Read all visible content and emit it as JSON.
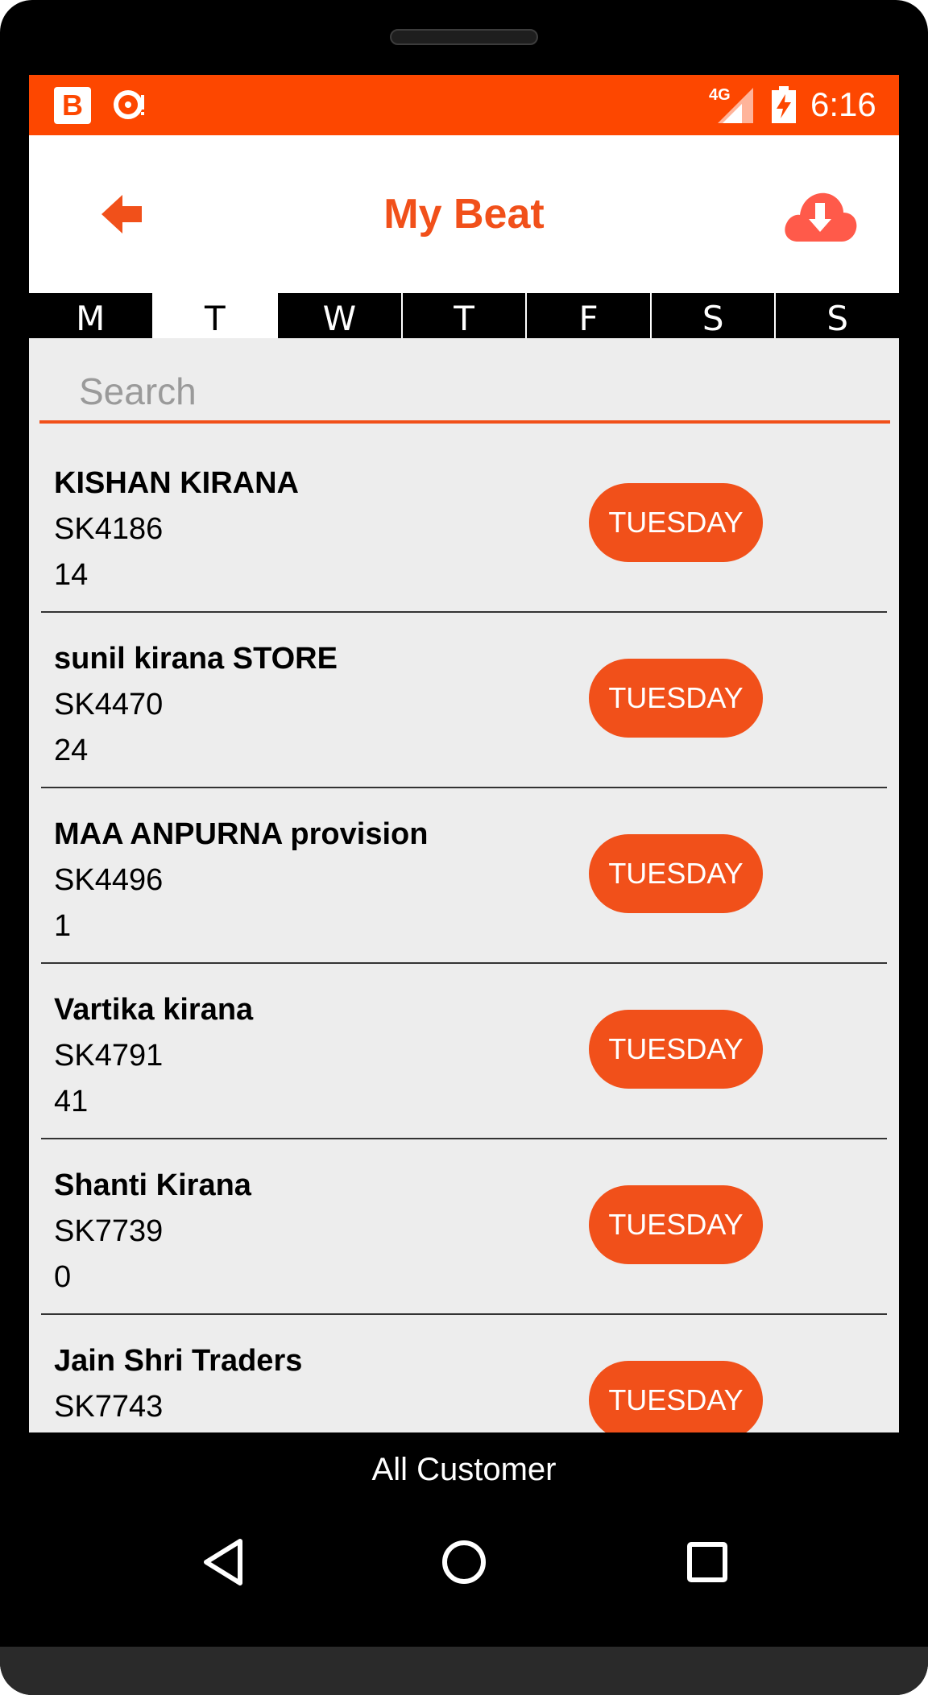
{
  "status_bar": {
    "app_badge_letter": "B",
    "network_label": "4G",
    "time": "6:16",
    "icons": [
      "blogger-app-icon",
      "sync-icon",
      "signal-icon",
      "battery-charging-icon"
    ]
  },
  "toolbar": {
    "title": "My Beat",
    "back_icon": "arrow-left-icon",
    "download_icon": "cloud-download-icon"
  },
  "days": {
    "items": [
      "M",
      "T",
      "W",
      "T",
      "F",
      "S",
      "S"
    ],
    "selected_index": 1
  },
  "search": {
    "placeholder": "Search",
    "value": ""
  },
  "customers": [
    {
      "name": "KISHAN KIRANA",
      "code": "SK4186",
      "count": "14",
      "day": "TUESDAY"
    },
    {
      "name": "sunil kirana STORE",
      "code": "SK4470",
      "count": "24",
      "day": "TUESDAY"
    },
    {
      "name": "MAA ANPURNA provision",
      "code": "SK4496",
      "count": "1",
      "day": "TUESDAY"
    },
    {
      "name": "Vartika kirana",
      "code": "SK4791",
      "count": "41",
      "day": "TUESDAY"
    },
    {
      "name": "Shanti Kirana",
      "code": "SK7739",
      "count": "0",
      "day": "TUESDAY"
    },
    {
      "name": "Jain Shri Traders",
      "code": "SK7743",
      "count": "",
      "day": "TUESDAY"
    }
  ],
  "footer": {
    "all_customer_label": "All Customer"
  },
  "system_nav": {
    "icons": [
      "nav-back-icon",
      "nav-home-icon",
      "nav-recents-icon"
    ]
  },
  "colors": {
    "status_bar": "#fd4700",
    "accent": "#f1501a",
    "list_background": "#ededed"
  }
}
